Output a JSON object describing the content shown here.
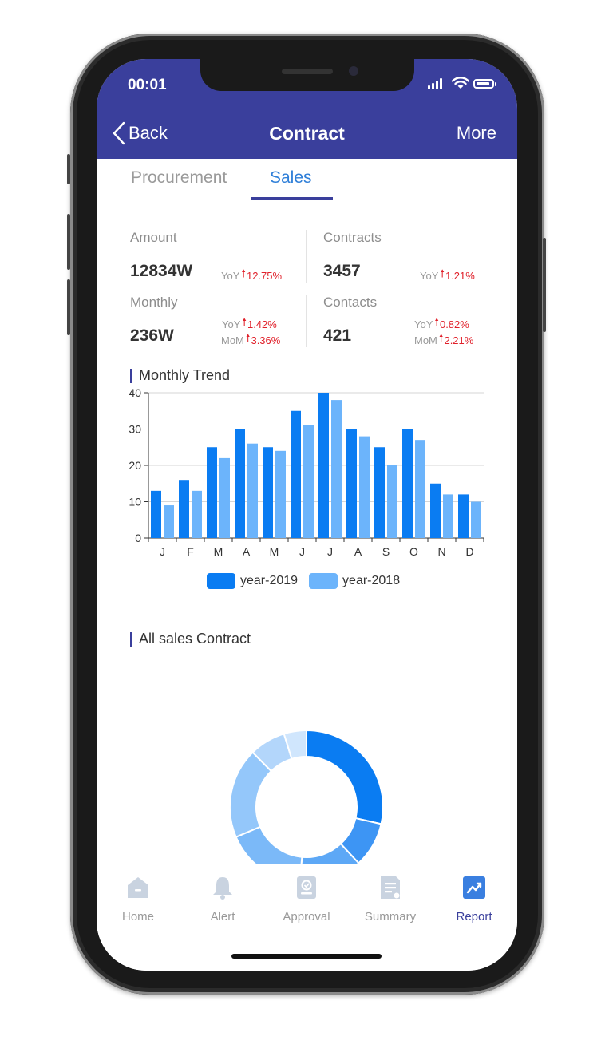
{
  "status_bar": {
    "time": "00:01"
  },
  "nav": {
    "back_label": "Back",
    "title": "Contract",
    "more_label": "More"
  },
  "tabs": [
    {
      "label": "Procurement",
      "active": false
    },
    {
      "label": "Sales",
      "active": true
    }
  ],
  "stats": {
    "amount": {
      "label": "Amount",
      "value": "12834W",
      "yoy_key": "YoY",
      "yoy": "12.75%"
    },
    "contracts": {
      "label": "Contracts",
      "value": "3457",
      "yoy_key": "YoY",
      "yoy": "1.21%"
    },
    "monthly": {
      "label": "Monthly",
      "value": "236W",
      "yoy_key": "YoY",
      "yoy": "1.42%",
      "mom_key": "MoM",
      "mom": "3.36%"
    },
    "contacts": {
      "label": "Contacts",
      "value": "421",
      "yoy_key": "YoY",
      "yoy": "0.82%",
      "mom_key": "MoM",
      "mom": "2.21%"
    }
  },
  "sections": {
    "monthly_trend": "Monthly Trend",
    "all_sales": "All sales Contract"
  },
  "chart_data": [
    {
      "type": "bar",
      "categories": [
        "J",
        "F",
        "M",
        "A",
        "M",
        "J",
        "J",
        "A",
        "S",
        "O",
        "N",
        "D"
      ],
      "series": [
        {
          "name": "year-2019",
          "values": [
            13,
            16,
            25,
            30,
            25,
            35,
            40,
            30,
            25,
            30,
            15,
            12
          ],
          "color": "#0a7cf2"
        },
        {
          "name": "year-2018",
          "values": [
            9,
            13,
            22,
            26,
            24,
            31,
            38,
            28,
            20,
            27,
            12,
            10
          ],
          "color": "#6cb4fb"
        }
      ],
      "yticks": [
        0,
        10,
        20,
        30,
        40
      ],
      "ylim": [
        0,
        40
      ],
      "grid": true,
      "legend": "bottom"
    },
    {
      "type": "pie",
      "donut": true,
      "values": [
        30,
        10,
        14,
        18,
        20,
        8,
        5
      ],
      "colors": [
        "#0a7cf2",
        "#3d95f4",
        "#5da8f6",
        "#7bb9f8",
        "#94c7fa",
        "#b3d6fb",
        "#d0e6fd"
      ],
      "partially_visible": true
    }
  ],
  "tabbar": [
    {
      "label": "Home",
      "icon": "home-icon",
      "active": false
    },
    {
      "label": "Alert",
      "icon": "bell-icon",
      "active": false
    },
    {
      "label": "Approval",
      "icon": "approval-icon",
      "active": false
    },
    {
      "label": "Summary",
      "icon": "summary-icon",
      "active": false
    },
    {
      "label": "Report",
      "icon": "report-icon",
      "active": true
    }
  ],
  "colors": {
    "primary": "#3a3f9c",
    "accent_blue": "#2f7fd8",
    "up_red": "#e0202a"
  }
}
